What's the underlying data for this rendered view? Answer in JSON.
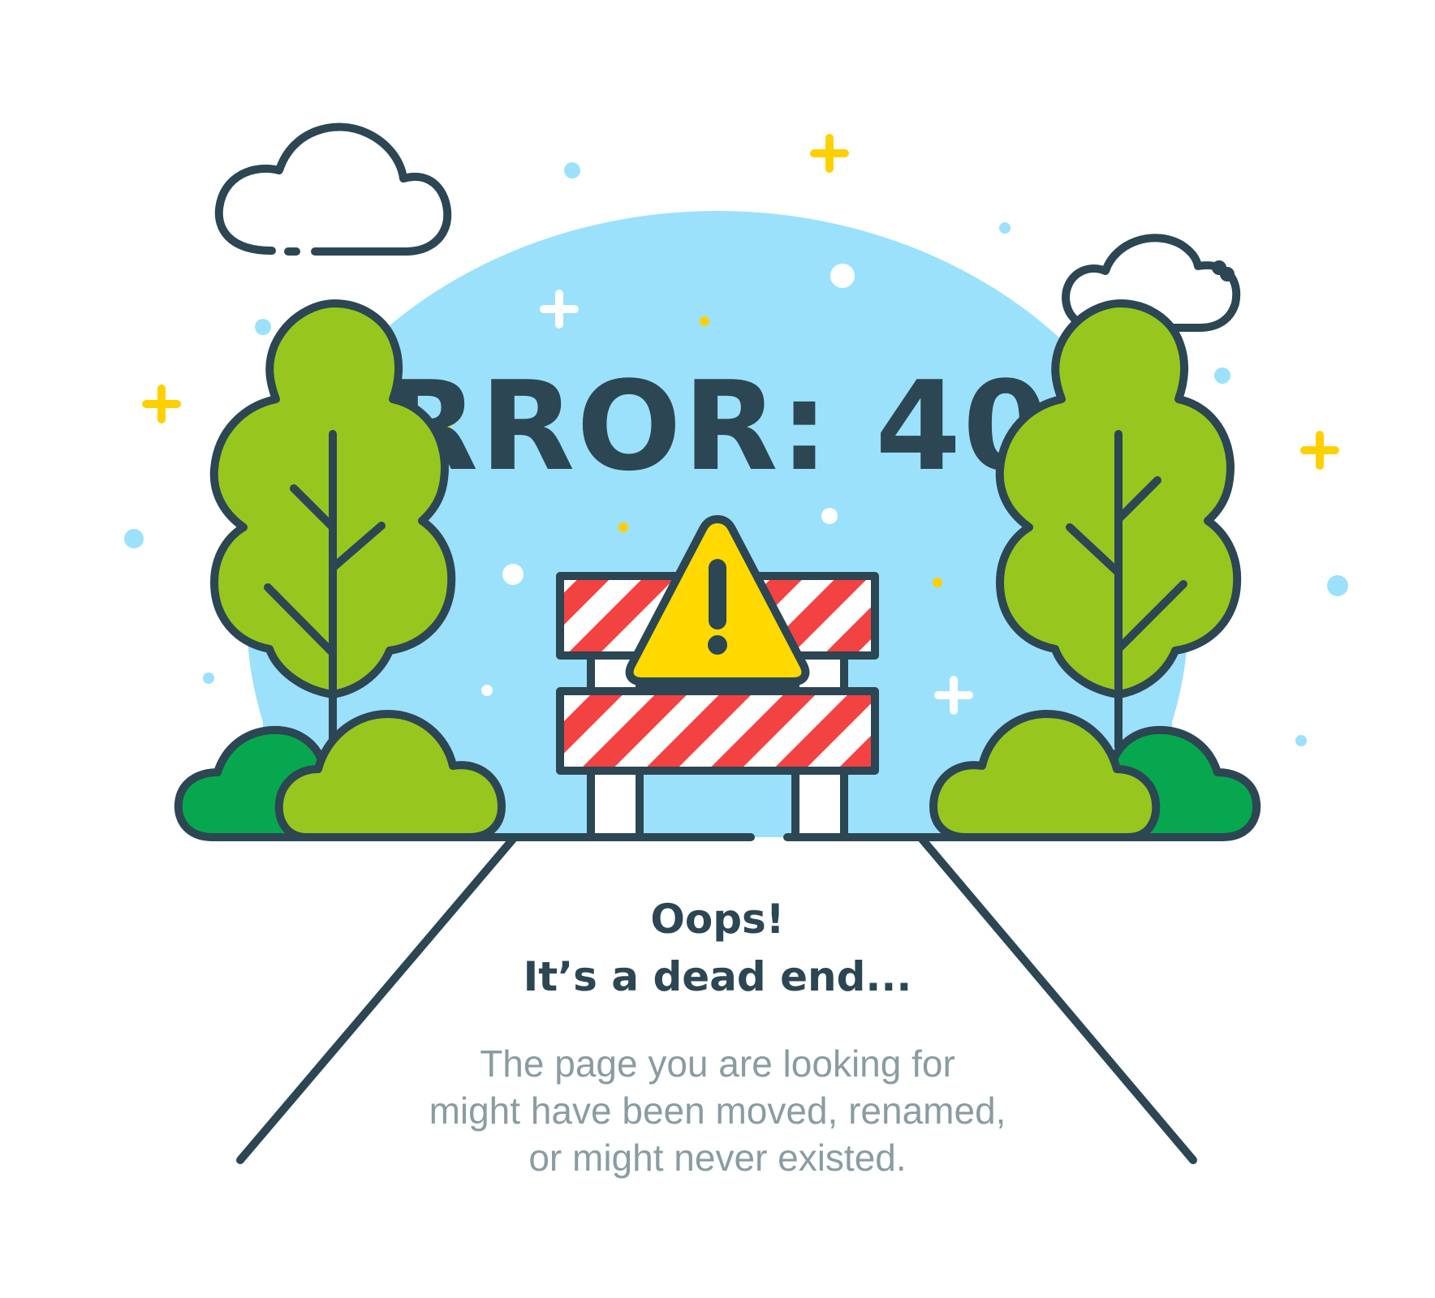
{
  "error": {
    "title": "ERROR: 404",
    "headline": "Oops!",
    "subhead": "It’s a dead end...",
    "message_lines": [
      "The page you are looking for",
      "might have been moved, renamed,",
      "or might never existed."
    ]
  },
  "colors": {
    "sky": "#9be1fb",
    "outline": "#2c4653",
    "tree": "#97c61f",
    "bush_dark": "#06a74e",
    "stripe_red": "#f34242",
    "warning": "#ffd900",
    "sparkle_yellow": "#ffd000",
    "sparkle_blue": "#9be1fb",
    "text_body": "#8a9ca2"
  },
  "icons": [
    "cloud-icon",
    "tree-icon",
    "bush-icon",
    "road-barrier-icon",
    "warning-triangle-icon",
    "sparkle-icon"
  ]
}
